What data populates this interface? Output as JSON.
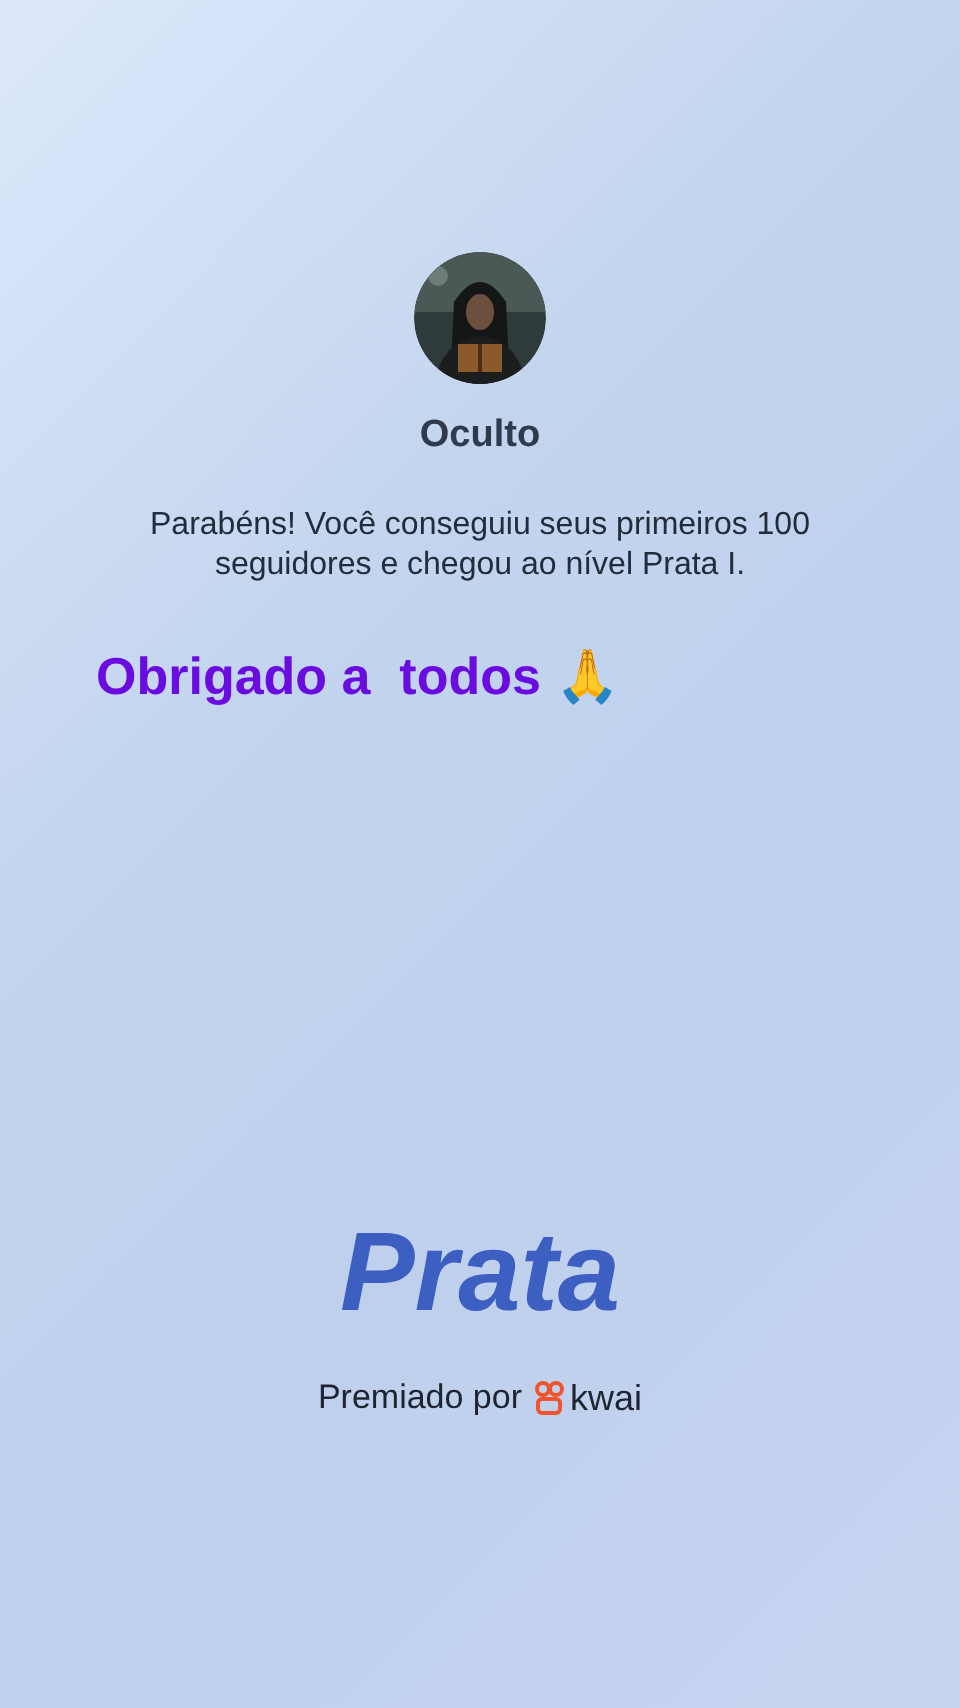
{
  "profile": {
    "name": "Oculto"
  },
  "message": "Parabéns! Você conseguiu seus primeiros 100 seguidores e chegou ao nível Prata I.",
  "caption": "Obrigado a  todos 🙏",
  "level_title": "Prata",
  "awarded_by": {
    "label": "Premiado por",
    "brand": "kwai"
  }
}
